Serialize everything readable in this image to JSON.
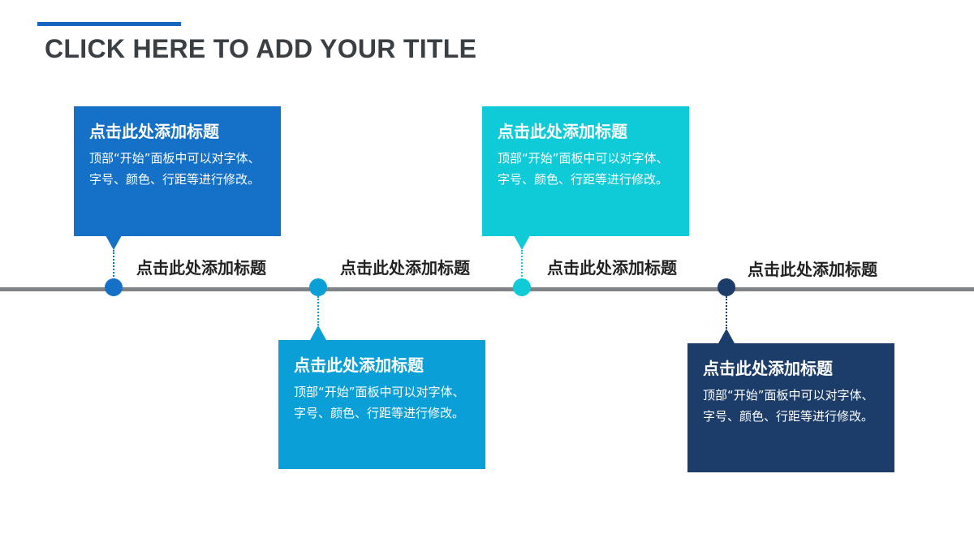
{
  "slide": {
    "title": "CLICK HERE TO ADD YOUR TITLE"
  },
  "colors": {
    "accent": "#1565c0",
    "timeline": "#808386",
    "milestone_1": "#1570c8",
    "milestone_2": "#0b9fd8",
    "milestone_3": "#0fcbd8",
    "milestone_4": "#1c3d6a"
  },
  "milestones": [
    {
      "label": "点击此处添加标题",
      "box_title": "点击此处添加标题",
      "box_text": "顶部“开始”面板中可以对字体、字号、颜色、行距等进行修改。"
    },
    {
      "label": "点击此处添加标题",
      "box_title": "点击此处添加标题",
      "box_text": "顶部“开始”面板中可以对字体、字号、颜色、行距等进行修改。"
    },
    {
      "label": "点击此处添加标题",
      "box_title": "点击此处添加标题",
      "box_text": "顶部“开始”面板中可以对字体、字号、颜色、行距等进行修改。"
    },
    {
      "label": "点击此处添加标题",
      "box_title": "点击此处添加标题",
      "box_text": "顶部“开始”面板中可以对字体、字号、颜色、行距等进行修改。"
    }
  ]
}
